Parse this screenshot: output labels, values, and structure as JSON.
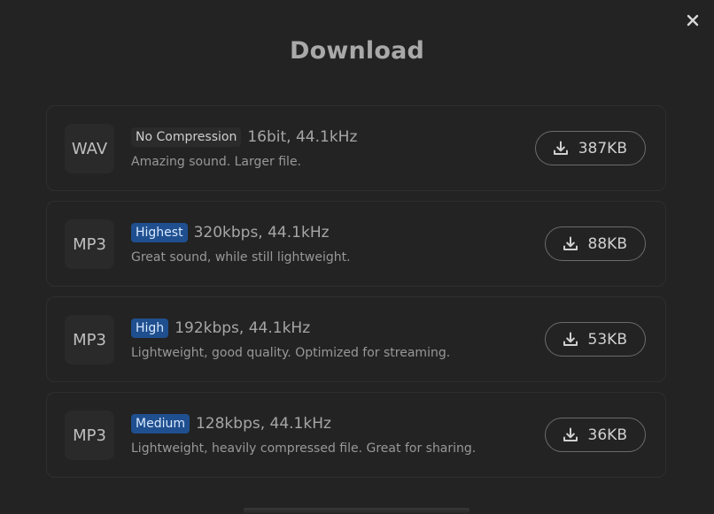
{
  "modal": {
    "title": "Download",
    "close_icon": "close-icon"
  },
  "options": [
    {
      "format": "WAV",
      "badge": "No Compression",
      "badge_color": "#2b2b2b",
      "spec": "16bit, 44.1kHz",
      "description": "Amazing sound. Larger file.",
      "size": "387KB",
      "icon": "download-icon"
    },
    {
      "format": "MP3",
      "badge": "Highest",
      "badge_color": "#1f4f8f",
      "spec": "320kbps, 44.1kHz",
      "description": "Great sound, while still lightweight.",
      "size": "88KB",
      "icon": "download-icon"
    },
    {
      "format": "MP3",
      "badge": "High",
      "badge_color": "#1f4f8f",
      "spec": "192kbps, 44.1kHz",
      "description": "Lightweight, good quality. Optimized for streaming.",
      "size": "53KB",
      "icon": "download-icon"
    },
    {
      "format": "MP3",
      "badge": "Medium",
      "badge_color": "#1f4f8f",
      "spec": "128kbps, 44.1kHz",
      "description": "Lightweight, heavily compressed file. Great for sharing.",
      "size": "36KB",
      "icon": "download-icon"
    }
  ]
}
